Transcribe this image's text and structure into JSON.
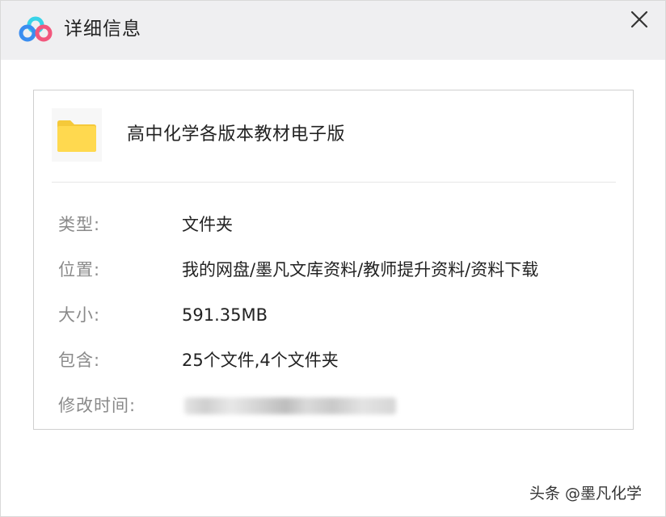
{
  "window": {
    "title": "详细信息",
    "app_icon": "baidu-netdisk-cloud-icon",
    "close_icon": "close-icon"
  },
  "file": {
    "icon": "folder-icon",
    "icon_color": "#FFD94F",
    "name": "高中化学各版本教材电子版"
  },
  "details": [
    {
      "label": "类型:",
      "value": "文件夹"
    },
    {
      "label": "位置:",
      "value": "我的网盘/墨凡文库资料/教师提升资料/资料下载"
    },
    {
      "label": "大小:",
      "value": "591.35MB"
    },
    {
      "label": "包含:",
      "value": "25个文件,4个文件夹"
    },
    {
      "label": "修改时间:",
      "value": ""
    }
  ],
  "watermark": "头条 @墨凡化学",
  "colors": {
    "titlebar_bg": "#EFEFF1",
    "label_text": "#8A8A8A",
    "value_text": "#222222",
    "logo_blue": "#3A8DF0",
    "logo_cyan": "#38D3E8",
    "logo_pink": "#F2577D"
  }
}
